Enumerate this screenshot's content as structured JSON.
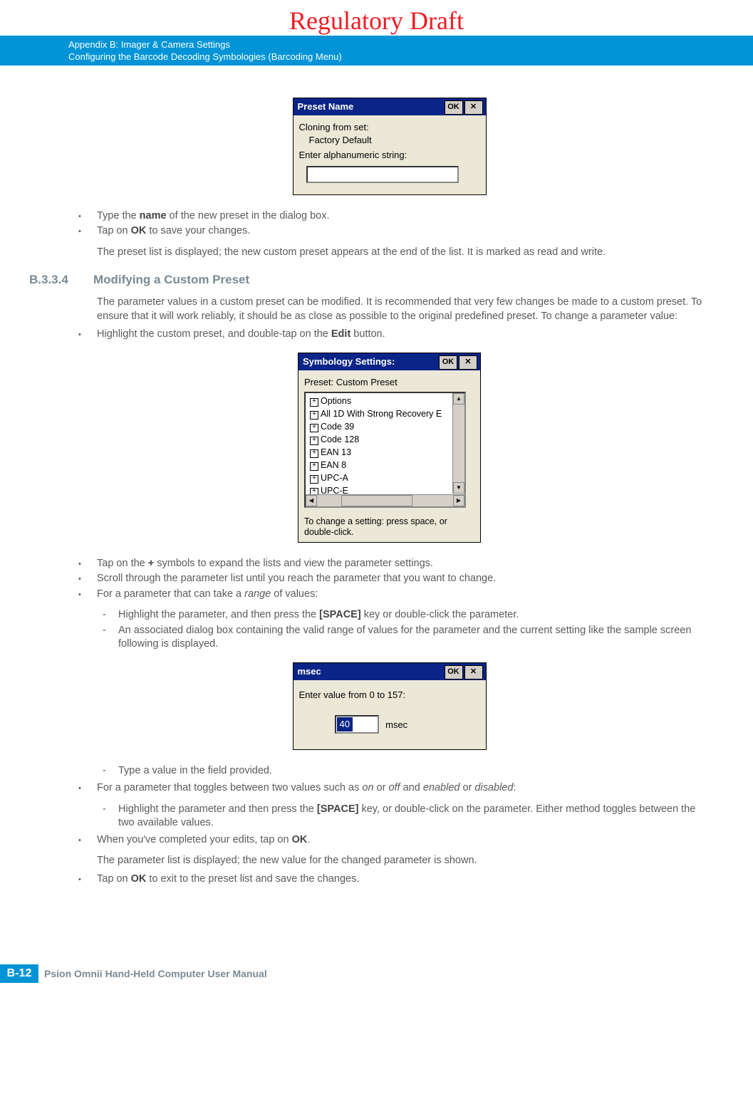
{
  "banner": "Regulatory Draft",
  "header": {
    "line1": "Appendix B: Imager & Camera Settings",
    "line2": "Configuring the Barcode Decoding Symbologies (Barcoding Menu)"
  },
  "dialog1": {
    "title": "Preset Name",
    "ok": "OK",
    "line1": "Cloning from set:",
    "line2": "Factory Default",
    "line3": "Enter alphanumeric string:"
  },
  "b1": {
    "i1a": "Type the ",
    "i1b": "name",
    "i1c": " of the new preset in the dialog box.",
    "i2a": "Tap on ",
    "i2b": "OK",
    "i2c": " to save your changes."
  },
  "p1": "The preset list is displayed; the new custom preset appears at the end of the list. It is marked as read and write.",
  "sec": {
    "num": "B.3.3.4",
    "title": "Modifying a Custom Preset"
  },
  "p2": "The parameter values in a custom preset can be modified. It is recommended that very few changes be made to a custom preset. To ensure that it will work reliably, it should be as close as possible to the original predefined preset. To change a parameter value:",
  "b2": {
    "i1a": "Highlight the custom preset, and double-tap on the ",
    "i1b": "Edit",
    "i1c": " button."
  },
  "dialog2": {
    "title": "Symbology Settings:",
    "ok": "OK",
    "preset": "Preset: Custom Preset",
    "items": {
      "0": "Options",
      "1": "All 1D With Strong Recovery E",
      "2": "Code 39",
      "3": "Code 128",
      "4": "EAN 13",
      "5": "EAN 8",
      "6": "UPC-A",
      "7": "UPC-E"
    },
    "hint": "To change a setting: press space, or double-click."
  },
  "b3": {
    "i1a": "Tap on the ",
    "i1b": "+",
    "i1c": " symbols to expand the lists and view the parameter settings.",
    "i2": "Scroll through the parameter list until you reach the parameter that you want to change.",
    "i3a": "For a parameter that can take a ",
    "i3b": "range",
    "i3c": " of values:"
  },
  "d1": {
    "i1a": "Highlight the parameter, and then press the ",
    "i1b": "[SPACE]",
    "i1c": " key or double-click the parameter.",
    "i2": "An associated dialog box containing the valid range of values for the parameter and the current setting like the sample screen following is displayed."
  },
  "dialog3": {
    "title": "msec",
    "ok": "OK",
    "prompt": "Enter value from 0 to 157:",
    "value": "40",
    "unit": "msec"
  },
  "d2": {
    "i1": "Type a value in the field provided."
  },
  "b4": {
    "i1a": "For a parameter that toggles between two values such as ",
    "i1b": "on",
    "i1c": " or ",
    "i1d": "off",
    "i1e": " and ",
    "i1f": "enabled",
    "i1g": " or ",
    "i1h": "disabled",
    "i1i": ":"
  },
  "d3": {
    "i1a": "Highlight the parameter and then press the ",
    "i1b": "[SPACE]",
    "i1c": " key, or double-click on the parameter. Either method toggles between the two available values."
  },
  "b5": {
    "i1a": "When you've completed your edits, tap on ",
    "i1b": "OK",
    "i1c": "."
  },
  "p3": "The parameter list is displayed; the new value for the changed parameter is shown.",
  "b6": {
    "i1a": "Tap on ",
    "i1b": "OK",
    "i1c": " to exit to the preset list and save the changes."
  },
  "footer": {
    "page": "B-12",
    "text": "Psion Omnii Hand-Held Computer User Manual"
  }
}
